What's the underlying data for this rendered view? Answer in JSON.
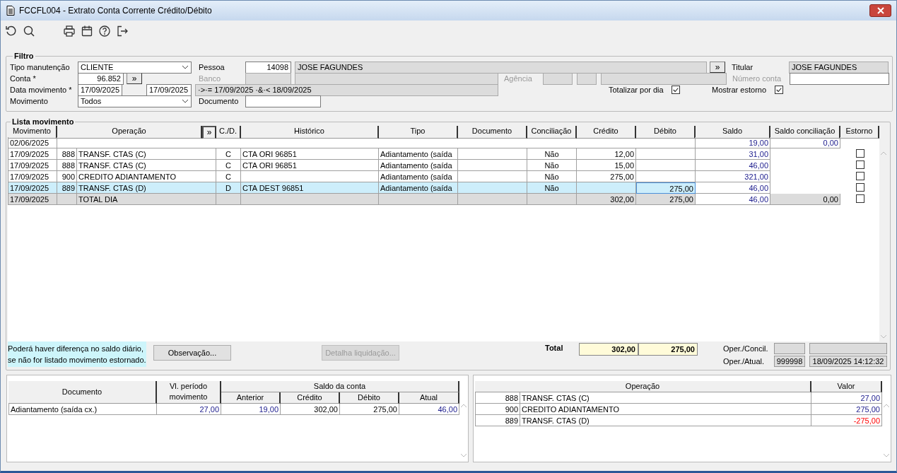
{
  "window": {
    "title": "FCCFL004 - Extrato Conta Corrente Crédito/Débito"
  },
  "filter": {
    "legend": "Filtro",
    "tipo_manutencao": {
      "label": "Tipo manutenção",
      "value": "CLIENTE"
    },
    "conta": {
      "label": "Conta *",
      "value": "96.852",
      "button": "»"
    },
    "data_movimento": {
      "label": "Data movimento *",
      "from": "17/09/2025",
      "to": "17/09/2025",
      "expression": "·>·= 17/09/2025 ·&·< 18/09/2025"
    },
    "movimento": {
      "label": "Movimento",
      "value": "Todos"
    },
    "pessoa": {
      "label": "Pessoa",
      "code": "14098",
      "name": "JOSE FAGUNDES",
      "button": "»"
    },
    "banco": {
      "label": "Banco",
      "disabled": true
    },
    "agencia": {
      "label": "Agência",
      "disabled": true
    },
    "documento": {
      "label": "Documento"
    },
    "titular": {
      "label": "Titular",
      "value": "JOSE FAGUNDES"
    },
    "numero_conta": {
      "label": "Número conta",
      "disabled": true
    },
    "totalizar": {
      "label": "Totalizar por dia",
      "checked": true
    },
    "mostrar_estorno": {
      "label": "Mostrar estorno",
      "checked": true
    }
  },
  "list": {
    "legend": "Lista movimento",
    "columns": [
      "Movimento",
      "Operação",
      "»",
      "C./D.",
      "Histórico",
      "Tipo",
      "Documento",
      "Conciliação",
      "Crédito",
      "Débito",
      "Saldo",
      "Saldo conciliação",
      "Estorno"
    ],
    "rows": [
      {
        "kind": "balance",
        "movimento": "02/06/2025",
        "saldo": "19,00",
        "saldo_conciliacao": "0,00"
      },
      {
        "kind": "entry",
        "selected": false,
        "movimento": "17/09/2025",
        "codigo": "888",
        "operacao": "TRANSF. CTAS (C)",
        "cd": "C",
        "historico": "CTA ORI  96851",
        "tipo": "Adiantamento (saída",
        "conciliacao": "Não",
        "credito": "12,00",
        "saldo": "31,00",
        "estorno": false
      },
      {
        "kind": "entry",
        "selected": false,
        "movimento": "17/09/2025",
        "codigo": "888",
        "operacao": "TRANSF. CTAS (C)",
        "cd": "C",
        "historico": "CTA ORI  96851",
        "tipo": "Adiantamento (saída",
        "conciliacao": "Não",
        "credito": "15,00",
        "saldo": "46,00",
        "estorno": false
      },
      {
        "kind": "entry",
        "selected": false,
        "movimento": "17/09/2025",
        "codigo": "900",
        "operacao": "CREDITO ADIANTAMENTO",
        "cd": "C",
        "tipo": "Adiantamento (saída",
        "conciliacao": "Não",
        "credito": "275,00",
        "saldo": "321,00",
        "estorno": false
      },
      {
        "kind": "entry",
        "selected": true,
        "movimento": "17/09/2025",
        "codigo": "889",
        "operacao": "TRANSF. CTAS (D)",
        "cd": "D",
        "historico": "CTA DEST  96851",
        "tipo": "Adiantamento (saída",
        "conciliacao": "Não",
        "debito": "275,00",
        "saldo": "46,00",
        "estorno": false
      },
      {
        "kind": "total",
        "movimento": "17/09/2025",
        "operacao": "TOTAL DIA",
        "credito": "302,00",
        "debito": "275,00",
        "saldo": "46,00",
        "saldo_conciliacao": "0,00",
        "estorno": false
      }
    ],
    "note": "Poderá haver diferença no saldo diário,\nse não for listado movimento estornado.",
    "buttons": [
      {
        "label": "Observação...",
        "disabled": false
      },
      {
        "label": "Detalha liquidação...",
        "disabled": true
      }
    ],
    "total": {
      "label": "Total",
      "credito": "302,00",
      "debito": "275,00"
    },
    "oper": {
      "concil_label": "Oper./Concil.",
      "atual_label": "Oper./Atual.",
      "atual_user": "999998",
      "atual_datetime": "18/09/2025 14:12:32"
    }
  },
  "doc_table": {
    "documento": "Documento",
    "vl_periodo": "Vl. período movimento",
    "saldo_conta": "Saldo da conta",
    "sub": [
      "Anterior",
      "Crédito",
      "Débito",
      "Atual"
    ],
    "rows": [
      {
        "documento": "Adiantamento (saída cx.)",
        "values": [
          "27,00",
          "19,00",
          "302,00",
          "275,00",
          "46,00"
        ]
      }
    ]
  },
  "op_table": {
    "columns": [
      "Operação",
      "Valor"
    ],
    "rows": [
      {
        "codigo": "888",
        "operacao": "TRANSF. CTAS (C)",
        "valor": "27,00",
        "negative": false
      },
      {
        "codigo": "900",
        "operacao": "CREDITO ADIANTAMENTO",
        "valor": "275,00",
        "negative": false
      },
      {
        "codigo": "889",
        "operacao": "TRANSF. CTAS (D)",
        "valor": "-275,00",
        "negative": true
      }
    ]
  }
}
